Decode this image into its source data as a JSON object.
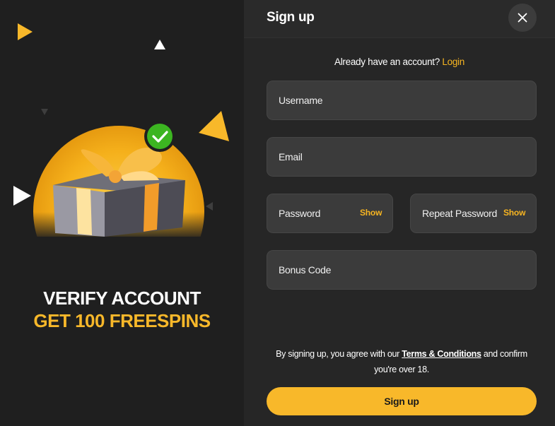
{
  "colors": {
    "accent": "#f8b82a",
    "success": "#3cb521",
    "field_bg": "#3b3b3b",
    "panel_bg": "#262626"
  },
  "promo": {
    "line1": "VERIFY ACCOUNT",
    "line2": "GET 100 FREESPINS"
  },
  "form": {
    "title": "Sign up",
    "close_icon": "close-icon",
    "already_text": "Already have an account?",
    "login_link": "Login",
    "username_placeholder": "Username",
    "email_placeholder": "Email",
    "password_placeholder": "Password",
    "password_show": "Show",
    "repeat_password_placeholder": "Repeat Password",
    "repeat_password_show": "Show",
    "bonus_placeholder": "Bonus Code",
    "terms_prefix": "By signing up, you agree with our",
    "terms_link": "Terms & Conditions",
    "terms_suffix": "and confirm you're over 18.",
    "submit_label": "Sign up"
  }
}
